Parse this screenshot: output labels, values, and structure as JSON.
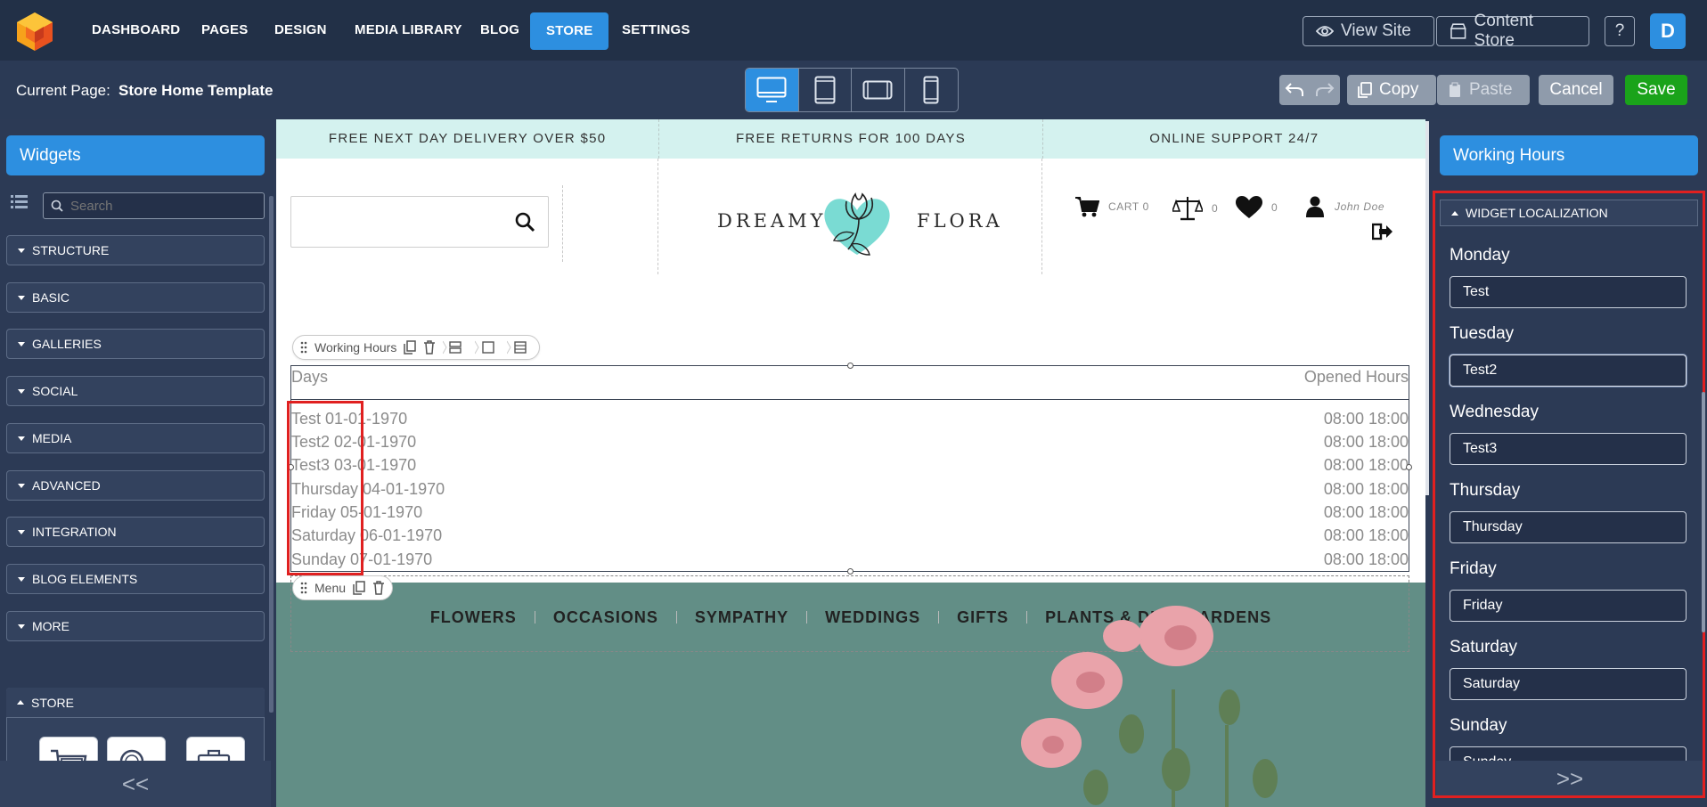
{
  "nav": {
    "items": [
      "DASHBOARD",
      "PAGES",
      "DESIGN",
      "MEDIA LIBRARY",
      "BLOG",
      "STORE",
      "SETTINGS"
    ],
    "view_site": "View Site",
    "content_store": "Content Store",
    "help": "?",
    "avatar": "D",
    "accent": "#2d8fe0"
  },
  "pagebar": {
    "label": "Current Page:",
    "page": "Store Home Template",
    "copy": "Copy",
    "paste": "Paste",
    "cancel": "Cancel",
    "save": "Save"
  },
  "left": {
    "title": "Widgets",
    "search_placeholder": "Search",
    "categories": [
      "STRUCTURE",
      "BASIC",
      "GALLERIES",
      "SOCIAL",
      "MEDIA",
      "ADVANCED",
      "INTEGRATION",
      "BLOG ELEMENTS",
      "MORE"
    ],
    "store_label": "STORE",
    "collapse": "<<"
  },
  "site": {
    "promos": [
      "FREE NEXT DAY DELIVERY OVER $50",
      "FREE RETURNS FOR 100 DAYS",
      "ONLINE SUPPORT 24/7"
    ],
    "brand_left": "DREAMY",
    "brand_right": "FLORA",
    "cart": "CART 0",
    "compare_count": "0",
    "wishlist_count": "0",
    "user": "John Doe"
  },
  "working_hours": {
    "toolbar_label": "Working Hours",
    "days_header": "Days",
    "hours_header": "Opened Hours",
    "rows": [
      {
        "day": "Test 01-01-1970",
        "hours": "08:00 18:00"
      },
      {
        "day": "Test2 02-01-1970",
        "hours": "08:00 18:00"
      },
      {
        "day": "Test3 03-01-1970",
        "hours": "08:00 18:00"
      },
      {
        "day": "Thursday 04-01-1970",
        "hours": "08:00 18:00"
      },
      {
        "day": "Friday 05-01-1970",
        "hours": "08:00 18:00"
      },
      {
        "day": "Saturday 06-01-1970",
        "hours": "08:00 18:00"
      },
      {
        "day": "Sunday 07-01-1970",
        "hours": "08:00 18:00"
      }
    ]
  },
  "menu": {
    "toolbar_label": "Menu",
    "items": [
      "FLOWERS",
      "OCCASIONS",
      "SYMPATHY",
      "WEDDINGS",
      "GIFTS",
      "PLANTS & DISH GARDENS"
    ]
  },
  "right": {
    "title": "Working Hours",
    "section": "WIDGET LOCALIZATION",
    "fields": [
      {
        "label": "Monday",
        "value": "Test"
      },
      {
        "label": "Tuesday",
        "value": "Test2"
      },
      {
        "label": "Wednesday",
        "value": "Test3"
      },
      {
        "label": "Thursday",
        "value": "Thursday"
      },
      {
        "label": "Friday",
        "value": "Friday"
      },
      {
        "label": "Saturday",
        "value": "Saturday"
      },
      {
        "label": "Sunday",
        "value": "Sunday"
      }
    ],
    "expand": ">>"
  }
}
